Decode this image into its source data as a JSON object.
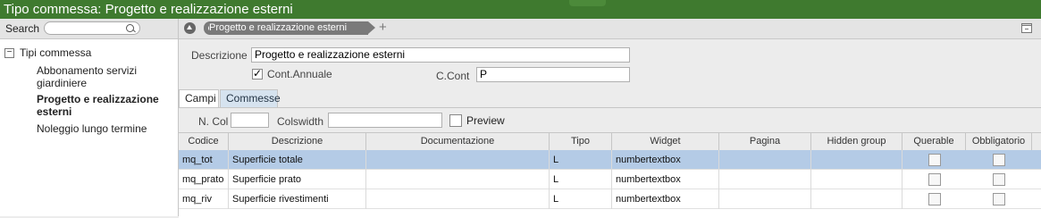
{
  "window": {
    "title": "Tipo commessa: Progetto e realizzazione esterni"
  },
  "sidebar": {
    "search_label": "Search",
    "search_placeholder": "",
    "tree_toggle": "−",
    "root_label": "Tipi commessa",
    "items": [
      {
        "label": "Abbonamento servizi giardiniere",
        "selected": false
      },
      {
        "label": "Progetto e realizzazione esterni",
        "selected": true
      },
      {
        "label": "Noleggio lungo termine",
        "selected": false
      }
    ]
  },
  "toolbar": {
    "breadcrumb": "Progetto e realizzazione esterni",
    "add_glyph": "+",
    "icons": [
      "home-icon",
      "archive-icon"
    ]
  },
  "form": {
    "descrizione_label": "Descrizione",
    "descrizione_value": "Progetto e realizzazione esterni",
    "cont_annuale_label": "Cont.Annuale",
    "cont_annuale_checked": true,
    "ccont_label": "C.Cont",
    "ccont_value": "P"
  },
  "tabs": [
    {
      "label": "Campi",
      "active": true
    },
    {
      "label": "Commesse",
      "active": false
    }
  ],
  "grid_options": {
    "ncol_label": "N. Col",
    "ncol_value": "",
    "colswidth_label": "Colswidth",
    "colswidth_value": "",
    "preview_label": "Preview",
    "preview_checked": false
  },
  "table": {
    "columns": [
      "Codice",
      "Descrizione",
      "Documentazione",
      "Tipo",
      "Widget",
      "Pagina",
      "Hidden group",
      "Querable",
      "Obbligatorio"
    ],
    "rows": [
      {
        "codice": "mq_tot",
        "descrizione": "Superficie totale",
        "documentazione": "",
        "tipo": "L",
        "widget": "numbertextbox",
        "pagina": "",
        "hidden_group": "",
        "querable": false,
        "obbligatorio": false,
        "selected": true
      },
      {
        "codice": "mq_prato",
        "descrizione": "Superficie prato",
        "documentazione": "",
        "tipo": "L",
        "widget": "numbertextbox",
        "pagina": "",
        "hidden_group": "",
        "querable": false,
        "obbligatorio": false,
        "selected": false
      },
      {
        "codice": "mq_riv",
        "descrizione": "Superficie rivestimenti",
        "documentazione": "",
        "tipo": "L",
        "widget": "numbertextbox",
        "pagina": "",
        "hidden_group": "",
        "querable": false,
        "obbligatorio": false,
        "selected": false
      }
    ]
  },
  "colors": {
    "titlebar": "#3f7a2f",
    "selected_row": "#b4cbe6",
    "inactive_tab": "#d6e3ef"
  }
}
